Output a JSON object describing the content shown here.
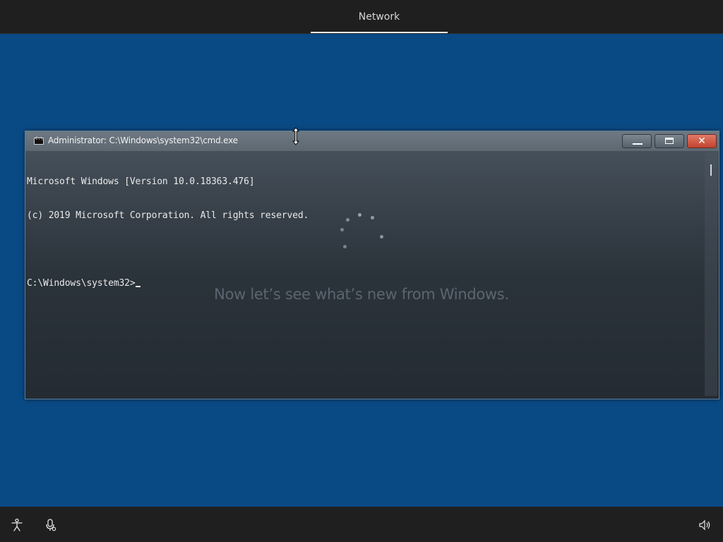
{
  "header": {
    "tab_label": "Network"
  },
  "window": {
    "title": "Administrator: C:\\Windows\\system32\\cmd.exe",
    "controls": {
      "minimize": "minimize",
      "maximize": "maximize",
      "close": "✕"
    },
    "console_lines": [
      "Microsoft Windows [Version 10.0.18363.476]",
      "(c) 2019 Microsoft Corporation. All rights reserved.",
      "",
      "C:\\Windows\\system32>"
    ]
  },
  "setup": {
    "message": "Now let’s see what’s new from Windows."
  },
  "footer": {
    "accessibility_icon": "accessibility-icon",
    "microphone_icon": "microphone-icon",
    "volume_icon": "volume-icon"
  },
  "colors": {
    "desktop_blue": "#0a4a84",
    "bar_dark": "#1f1f1f",
    "close_red": "#c2432f"
  }
}
